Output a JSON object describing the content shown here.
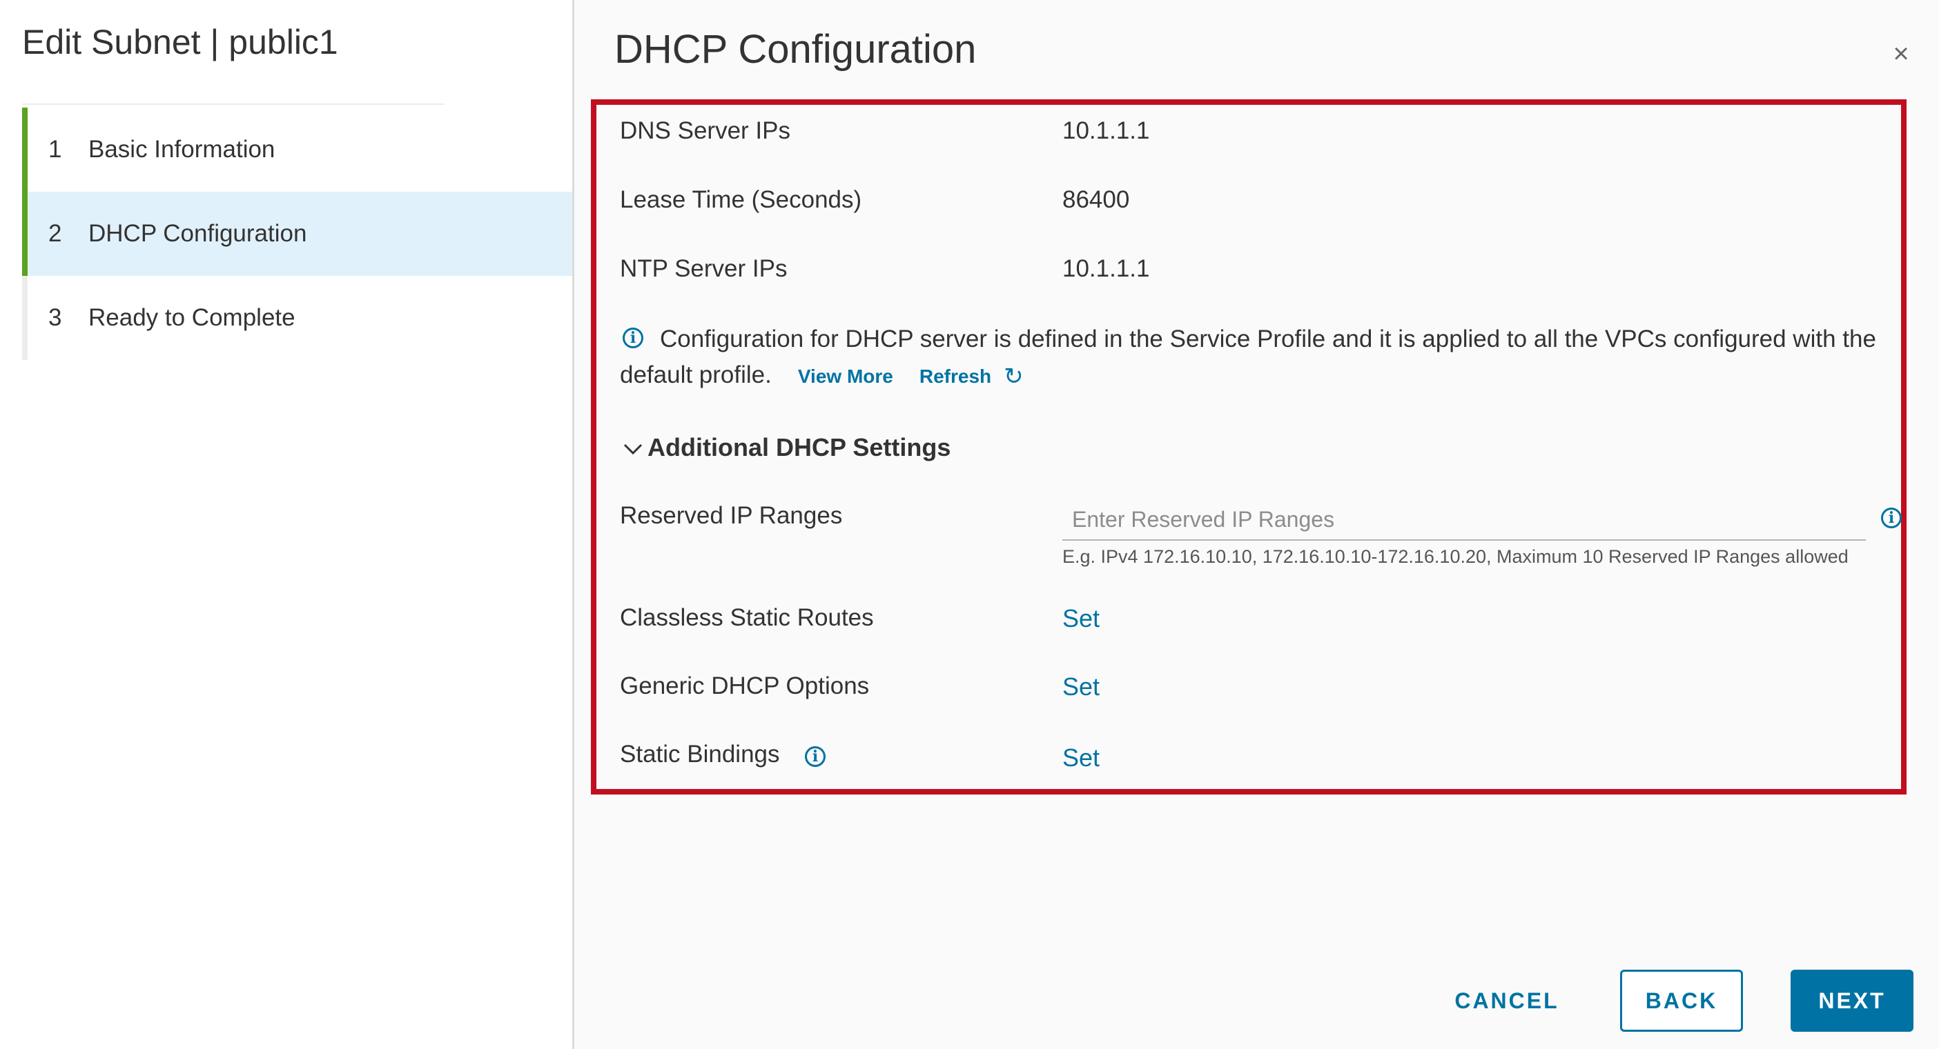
{
  "wizard": {
    "title": "Edit Subnet | public1",
    "steps": [
      {
        "number": "1",
        "label": "Basic Information",
        "state": "completed"
      },
      {
        "number": "2",
        "label": "DHCP Configuration",
        "state": "active"
      },
      {
        "number": "3",
        "label": "Ready to Complete",
        "state": "future"
      }
    ]
  },
  "page": {
    "title": "DHCP Configuration",
    "close_glyph": "×"
  },
  "config": {
    "dns_label": "DNS Server IPs",
    "dns_value": "10.1.1.1",
    "lease_label": "Lease Time (Seconds)",
    "lease_value": "86400",
    "ntp_label": "NTP Server IPs",
    "ntp_value": "10.1.1.1",
    "info_message": "Configuration for DHCP server is defined in the Service Profile and it is applied to all the VPCs configured with the default profile.",
    "view_more": "View More",
    "refresh": "Refresh"
  },
  "additional": {
    "section_title": "Additional DHCP Settings",
    "reserved_label": "Reserved IP Ranges",
    "reserved_placeholder": "Enter Reserved IP Ranges",
    "reserved_value": "",
    "reserved_helper": "E.g. IPv4 172.16.10.10, 172.16.10.10-172.16.10.20, Maximum 10 Reserved IP Ranges allowed",
    "classless_label": "Classless Static Routes",
    "classless_link": "Set",
    "generic_label": "Generic DHCP Options",
    "generic_link": "Set",
    "static_label": "Static Bindings",
    "static_link": "Set"
  },
  "footer": {
    "cancel": "CANCEL",
    "back": "BACK",
    "next": "NEXT"
  },
  "icons": {
    "info": "info-icon",
    "refresh": "refresh-icon",
    "chevron": "chevron-down-icon",
    "close": "close-icon"
  },
  "colors": {
    "accent": "#0072a3",
    "step_complete": "#5aa220",
    "active_step_bg": "#e1f1fb",
    "highlight_border": "#c10f1f"
  }
}
